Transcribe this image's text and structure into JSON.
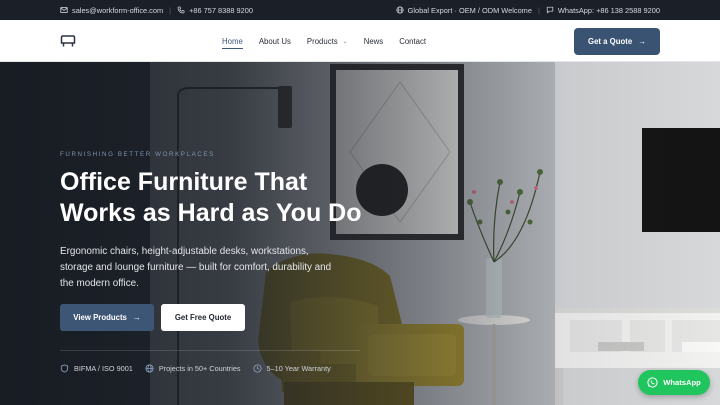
{
  "topbar": {
    "email": "sales@workform-office.com",
    "phone": "+86 757 8388 9200",
    "export_text": "Global Export · OEM / ODM Welcome",
    "whatsapp_text": "WhatsApp: +86 138 2588 9200"
  },
  "nav": {
    "items": [
      {
        "label": "Home",
        "active": true
      },
      {
        "label": "About Us"
      },
      {
        "label": "Products",
        "has_dropdown": true
      },
      {
        "label": "News"
      },
      {
        "label": "Contact"
      }
    ],
    "cta_label": "Get a Quote"
  },
  "hero": {
    "eyebrow": "FURNISHING BETTER WORKPLACES",
    "headline_line1": "Office Furniture That",
    "headline_line2": "Works as Hard as You Do",
    "lead_line1": "Ergonomic chairs, height-adjustable desks, workstations,",
    "lead_line2": "storage and lounge furniture — built for comfort, durability and",
    "lead_line3": "the modern office.",
    "primary_button": "View Products",
    "secondary_button": "Get Free Quote",
    "badges": [
      {
        "icon": "shield-icon",
        "label": "BIFMA / ISO 9001"
      },
      {
        "icon": "globe-icon",
        "label": "Projects in 50+ Countries"
      },
      {
        "icon": "clock-icon",
        "label": "5–10 Year Warranty"
      }
    ]
  },
  "floating": {
    "whatsapp_label": "WhatsApp"
  },
  "colors": {
    "topbar_bg": "#1b1f27",
    "brand_blue": "#3a5373",
    "whatsapp_green": "#21c55d"
  }
}
